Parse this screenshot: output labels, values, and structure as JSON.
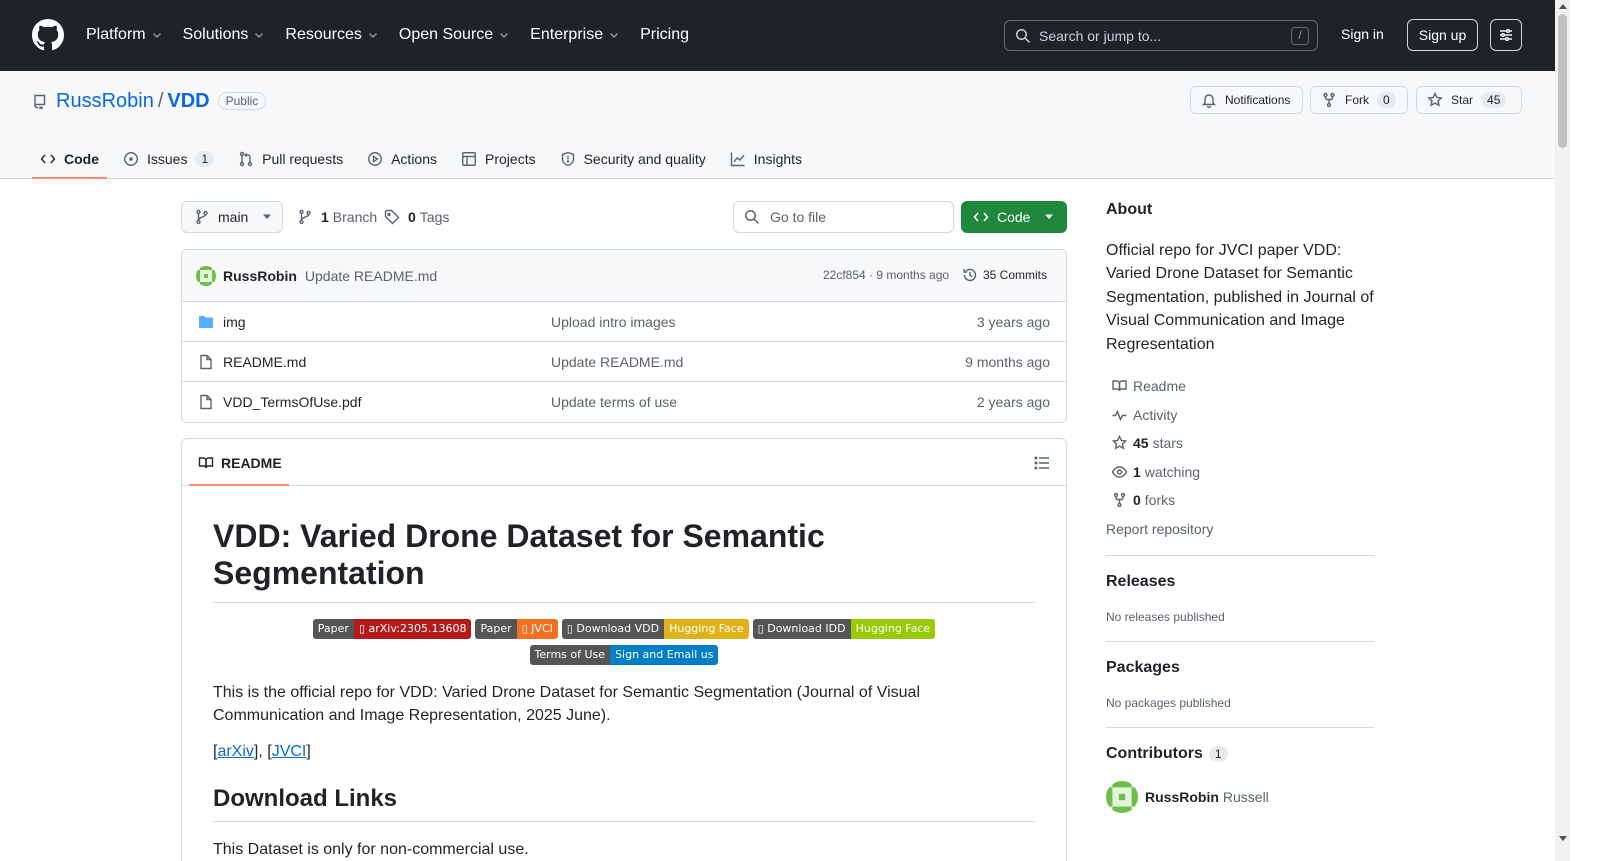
{
  "header": {
    "nav": [
      {
        "label": "Platform",
        "dropdown": true
      },
      {
        "label": "Solutions",
        "dropdown": true
      },
      {
        "label": "Resources",
        "dropdown": true
      },
      {
        "label": "Open Source",
        "dropdown": true
      },
      {
        "label": "Enterprise",
        "dropdown": true
      },
      {
        "label": "Pricing",
        "dropdown": false
      }
    ],
    "search_placeholder": "Search or jump to...",
    "search_key": "/",
    "sign_in": "Sign in",
    "sign_up": "Sign up"
  },
  "repo": {
    "owner": "RussRobin",
    "separator": "/",
    "name": "VDD",
    "visibility": "Public",
    "notifications_label": "Notifications",
    "fork_label": "Fork",
    "fork_count": "0",
    "star_label": "Star",
    "star_count": "45"
  },
  "tabs": [
    {
      "label": "Code",
      "icon": "code-icon",
      "active": true,
      "counter": ""
    },
    {
      "label": "Issues",
      "icon": "issue-icon",
      "active": false,
      "counter": "1"
    },
    {
      "label": "Pull requests",
      "icon": "pull-request-icon",
      "active": false,
      "counter": ""
    },
    {
      "label": "Actions",
      "icon": "play-icon",
      "active": false,
      "counter": ""
    },
    {
      "label": "Projects",
      "icon": "table-icon",
      "active": false,
      "counter": ""
    },
    {
      "label": "Security and quality",
      "icon": "shield-icon",
      "active": false,
      "counter": ""
    },
    {
      "label": "Insights",
      "icon": "graph-icon",
      "active": false,
      "counter": ""
    }
  ],
  "controls": {
    "branch": "main",
    "branch_count": "1",
    "branch_label": "Branch",
    "tag_count": "0",
    "tag_label": "Tags",
    "goto_placeholder": "Go to file",
    "code_button": "Code"
  },
  "latest_commit": {
    "author": "RussRobin",
    "message": "Update README.md",
    "meta": "22cf854 · 9 months ago",
    "commits": "35 Commits"
  },
  "files": [
    {
      "type": "folder",
      "name": "img",
      "message": "Upload intro images",
      "age": "3 years ago"
    },
    {
      "type": "file",
      "name": "README.md",
      "message": "Update README.md",
      "age": "9 months ago"
    },
    {
      "type": "file",
      "name": "VDD_TermsOfUse.pdf",
      "message": "Update terms of use",
      "age": "2 years ago"
    }
  ],
  "readme": {
    "tab_label": "README",
    "title": "VDD: Varied Drone Dataset for Semantic Segmentation",
    "badges": [
      {
        "left": "Paper",
        "right": "▯ arXiv:2305.13608",
        "color": "#b31b1b"
      },
      {
        "left": "Paper",
        "right": "▯ JVCI",
        "color": "#f37021"
      },
      {
        "left": "▯ Download VDD",
        "right": "Hugging Face",
        "color": "#dfb317"
      },
      {
        "left": "▯ Download IDD",
        "right": "Hugging Face",
        "color": "#97ca00"
      },
      {
        "left": "Terms of Use",
        "right": "Sign and Email us",
        "color": "#007ec6"
      }
    ],
    "intro": "This is the official repo for VDD: Varied Drone Dataset for Semantic Segmentation (Journal of Visual Communication and Image Representation, 2025 June).",
    "links_open": "[",
    "link1": "arXiv",
    "links_mid": "], [",
    "link2": "JVCI",
    "links_close": "]",
    "h2": "Download Links",
    "p2": "This Dataset is only for non-commercial use."
  },
  "sidebar": {
    "about_title": "About",
    "description": "Official repo for JVCI paper VDD: Varied Drone Dataset for Semantic Segmentation, published in Journal of Visual Communication and Image Regresentation",
    "items": [
      {
        "icon": "book-icon",
        "bold": "",
        "label": "Readme"
      },
      {
        "icon": "pulse-icon",
        "bold": "",
        "label": "Activity"
      },
      {
        "icon": "star-icon",
        "bold": "45",
        "label": "stars"
      },
      {
        "icon": "eye-icon",
        "bold": "1",
        "label": "watching"
      },
      {
        "icon": "fork-icon",
        "bold": "0",
        "label": "forks"
      }
    ],
    "report": "Report repository",
    "releases_title": "Releases",
    "releases_empty": "No releases published",
    "packages_title": "Packages",
    "packages_empty": "No packages published",
    "contributors_title": "Contributors",
    "contributors_count": "1",
    "contributor_login": "RussRobin",
    "contributor_name": "Russell"
  },
  "colors": {
    "header_bg": "#1f2328",
    "accent_blue": "#0969da",
    "code_green": "#1f883d",
    "tab_underline": "#fd8c73"
  }
}
